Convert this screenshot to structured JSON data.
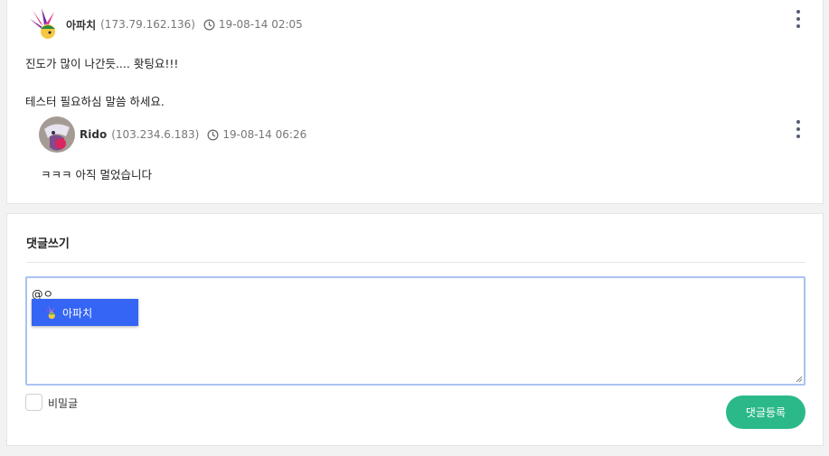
{
  "comments": [
    {
      "author": "아파치",
      "ip": "(173.79.162.136)",
      "date": "19-08-14 02:05",
      "lines": [
        "진도가 많이 나간듯.... 홧팅요!!!",
        "테스터 필요하심 말씀 하세요."
      ]
    },
    {
      "author": "Rido",
      "ip": "(103.234.6.183)",
      "date": "19-08-14 06:26",
      "lines": [
        "ㅋㅋㅋ 아직 멀었습니다"
      ]
    }
  ],
  "write": {
    "title": "댓글쓰기",
    "typed_text": "@ㅇ",
    "mention_suggestion": "아파치",
    "secret_label": "비밀글",
    "submit_label": "댓글등록"
  },
  "colors": {
    "accent": "#2bb98a",
    "mention_highlight": "#3465f5",
    "focus_border": "#a9c3f2"
  },
  "icons": [
    "clock-icon",
    "more-vertical-icon",
    "user-avatar"
  ]
}
